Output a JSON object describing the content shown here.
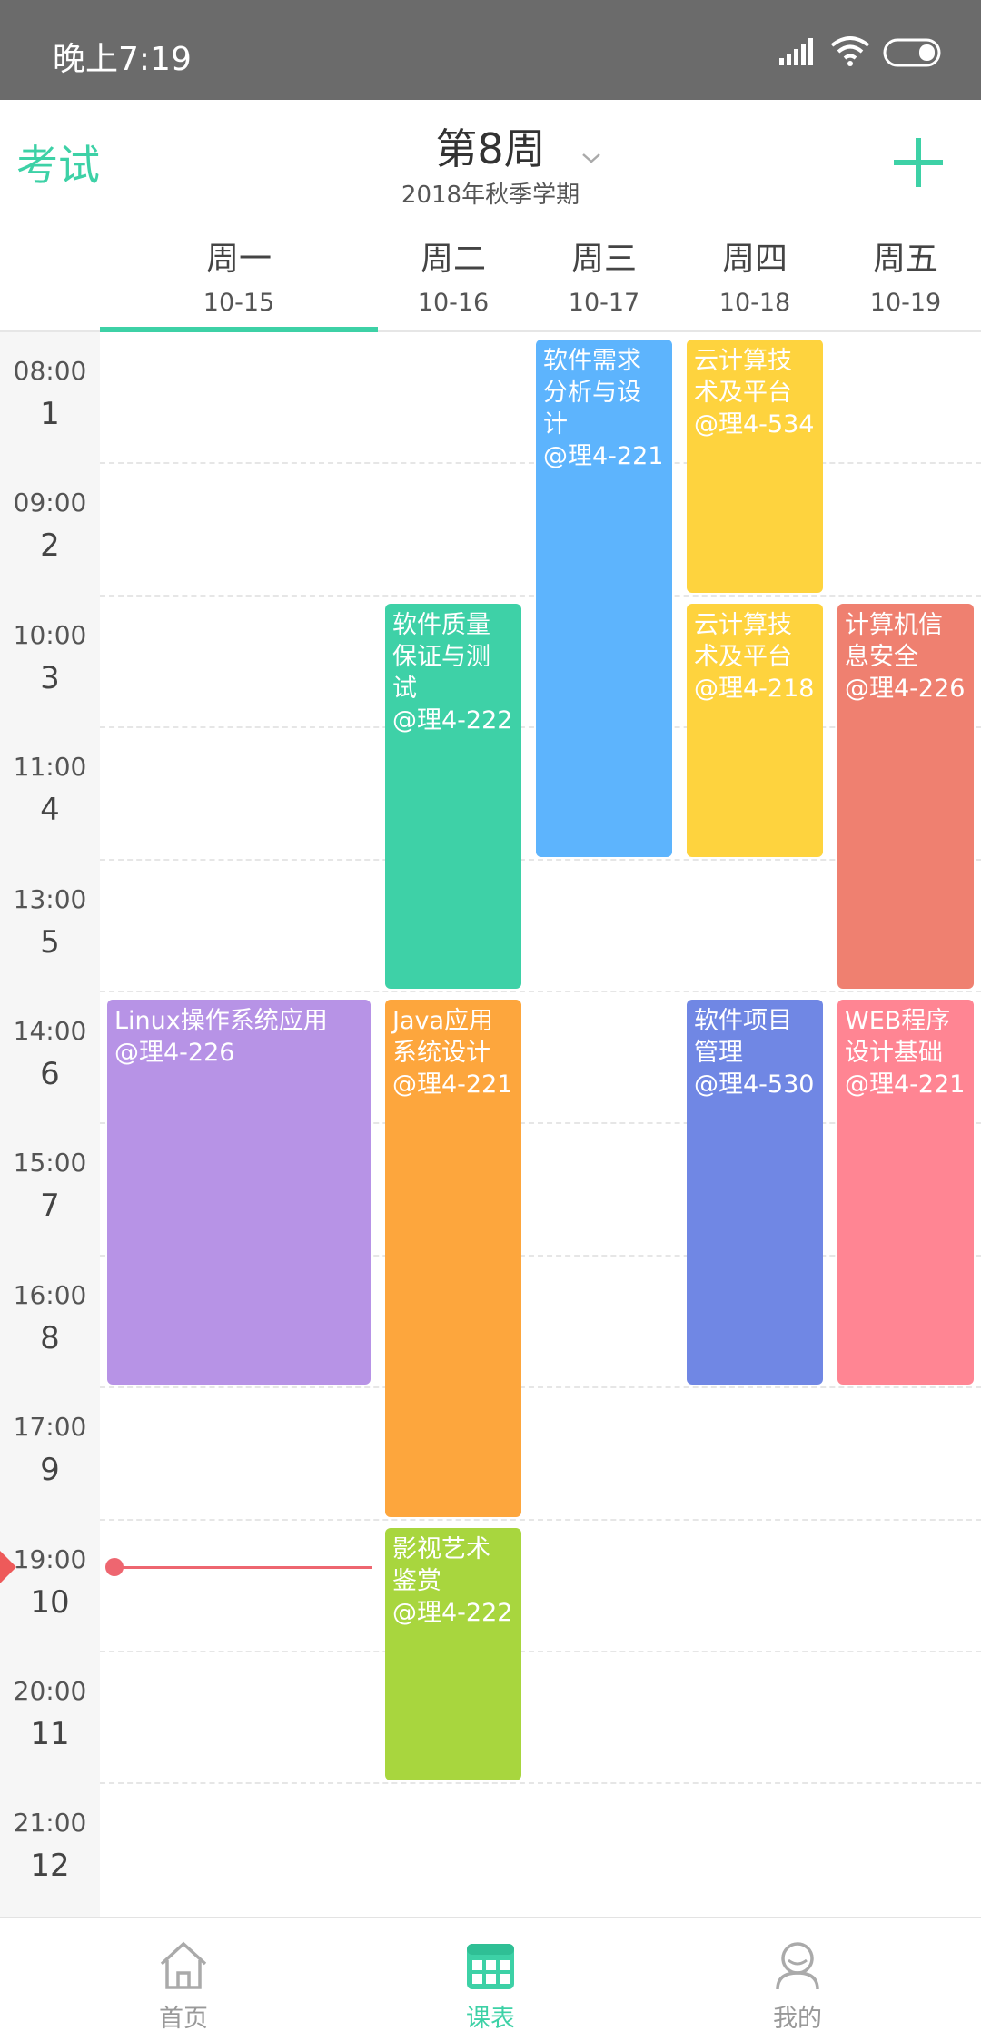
{
  "status_bar": {
    "time": "晚上7:19"
  },
  "header": {
    "exam_label": "考试",
    "week_title": "第8周",
    "term": "2018年秋季学期",
    "add_icon": "plus-icon",
    "dropdown_icon": "chevron-down-icon"
  },
  "days": [
    {
      "name": "周一",
      "date": "10-15",
      "active": true
    },
    {
      "name": "周二",
      "date": "10-16",
      "active": false
    },
    {
      "name": "周三",
      "date": "10-17",
      "active": false
    },
    {
      "name": "周四",
      "date": "10-18",
      "active": false
    },
    {
      "name": "周五",
      "date": "10-19",
      "active": false
    }
  ],
  "periods": [
    {
      "time": "08:00",
      "num": "1"
    },
    {
      "time": "09:00",
      "num": "2"
    },
    {
      "time": "10:00",
      "num": "3"
    },
    {
      "time": "11:00",
      "num": "4"
    },
    {
      "time": "13:00",
      "num": "5"
    },
    {
      "time": "14:00",
      "num": "6"
    },
    {
      "time": "15:00",
      "num": "7"
    },
    {
      "time": "16:00",
      "num": "8"
    },
    {
      "time": "17:00",
      "num": "9"
    },
    {
      "time": "19:00",
      "num": "10"
    },
    {
      "time": "20:00",
      "num": "11"
    },
    {
      "time": "21:00",
      "num": "12"
    }
  ],
  "courses": [
    {
      "day": 0,
      "start": 6,
      "end": 8,
      "text": "Linux操作系统应用\n@理4-226",
      "color": "#b793e6"
    },
    {
      "day": 1,
      "start": 3,
      "end": 5,
      "text": "软件质量保证与测试\n@理4-222",
      "color": "#3ed1a7"
    },
    {
      "day": 1,
      "start": 6,
      "end": 9,
      "text": "Java应用系统设计\n@理4-221",
      "color": "#fda63d"
    },
    {
      "day": 1,
      "start": 10,
      "end": 11,
      "text": "影视艺术鉴赏\n@理4-222",
      "color": "#a8d63e"
    },
    {
      "day": 2,
      "start": 1,
      "end": 4,
      "text": "软件需求分析与设计\n@理4-221",
      "color": "#5db4fd"
    },
    {
      "day": 3,
      "start": 1,
      "end": 2,
      "text": "云计算技术及平台\n@理4-534",
      "color": "#fed33e"
    },
    {
      "day": 3,
      "start": 3,
      "end": 4,
      "text": "云计算技术及平台\n@理4-218",
      "color": "#fed33e"
    },
    {
      "day": 3,
      "start": 6,
      "end": 8,
      "text": "软件项目管理\n@理4-530",
      "color": "#7087e4"
    },
    {
      "day": 4,
      "start": 3,
      "end": 5,
      "text": "计算机信息安全\n@理4-226",
      "color": "#ef8070"
    },
    {
      "day": 4,
      "start": 6,
      "end": 8,
      "text": "WEB程序设计基础\n@理4-221",
      "color": "#ff8593"
    }
  ],
  "bottom_nav": [
    {
      "label": "首页",
      "icon": "home-icon",
      "active": false
    },
    {
      "label": "课表",
      "icon": "timetable-icon",
      "active": true
    },
    {
      "label": "我的",
      "icon": "profile-icon",
      "active": false
    }
  ],
  "colors": {
    "accent": "#3dd1a6",
    "current_time": "#ee6670"
  }
}
